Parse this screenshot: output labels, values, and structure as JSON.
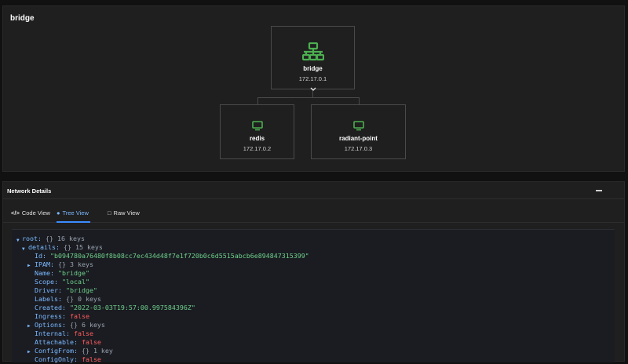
{
  "graph": {
    "title": "bridge",
    "root": {
      "name": "bridge",
      "ip": "172.17.0.1",
      "icon": "network-switch-icon"
    },
    "children": [
      {
        "name": "redis",
        "ip": "172.17.0.2",
        "icon": "monitor-icon"
      },
      {
        "name": "radiant-point",
        "ip": "172.17.0.3",
        "icon": "monitor-icon"
      }
    ],
    "accent": "#4caf50"
  },
  "details": {
    "title": "Network Details",
    "tabs": {
      "code": "Code View",
      "tree": "Tree View",
      "raw": "Raw View"
    },
    "tree": {
      "root_key": "root:",
      "root_meta": "{} 16 keys",
      "details_key": "details:",
      "details_meta": "{} 15 keys",
      "id_key": "Id:",
      "id_val": "\"b094780a76480f8b08cc7ec434d48f7e1f720b0c6d5515abcb6e894847315399\"",
      "ipam_key": "IPAM:",
      "ipam_meta": "{} 3 keys",
      "name_key": "Name:",
      "name_val": "\"bridge\"",
      "scope_key": "Scope:",
      "scope_val": "\"local\"",
      "driver_key": "Driver:",
      "driver_val": "\"bridge\"",
      "labels_key": "Labels:",
      "labels_meta": "{} 0 keys",
      "created_key": "Created:",
      "created_val": "\"2022-03-03T19:57:00.997584396Z\"",
      "ingress_key": "Ingress:",
      "ingress_val": "false",
      "options_key": "Options:",
      "options_meta": "{} 6 keys",
      "internal_key": "Internal:",
      "internal_val": "false",
      "attachable_key": "Attachable:",
      "attachable_val": "false",
      "configfrom_key": "ConfigFrom:",
      "configfrom_meta": "{} 1 key",
      "configonly_key": "ConfigOnly:",
      "configonly_val": "false"
    }
  }
}
